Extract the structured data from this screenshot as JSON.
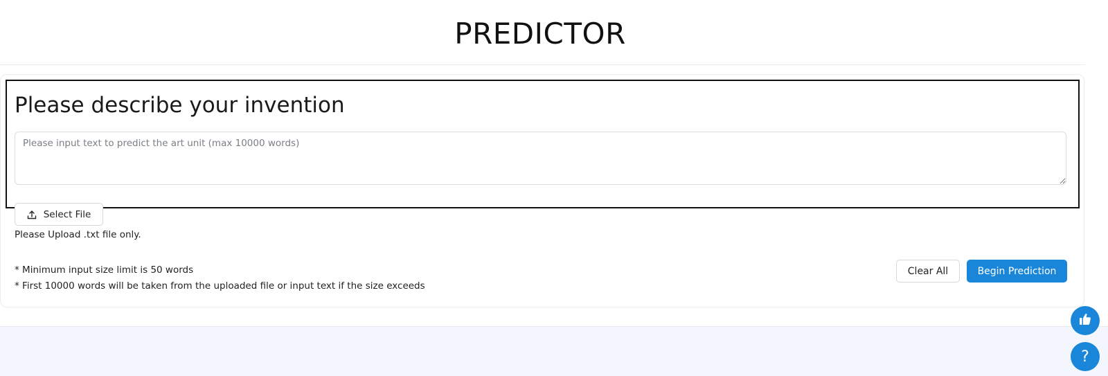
{
  "header": {
    "title": "PREDICTOR"
  },
  "form": {
    "heading": "Please describe your invention",
    "textarea_placeholder": "Please input text to predict the art unit (max 10000 words)",
    "textarea_value": "",
    "select_file_label": "Select File",
    "upload_note": "Please Upload .txt file only.",
    "notes": [
      "* Minimum input size limit is 50 words",
      "* First 10000 words will be taken from the uploaded file or input text if the size exceeds"
    ],
    "clear_label": "Clear All",
    "begin_label": "Begin Prediction"
  },
  "floating_buttons": {
    "like_icon": "thumbs-up-icon",
    "help_icon": "question-icon",
    "help_glyph": "?"
  },
  "colors": {
    "accent": "#1a86d9",
    "bottom_background": "#f3f6fd"
  }
}
